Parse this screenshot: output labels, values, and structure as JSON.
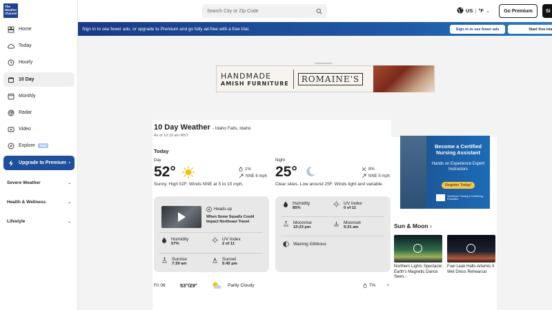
{
  "brand": {
    "logo_text": "The Weather Channel"
  },
  "sidebar": {
    "items": [
      {
        "label": "Home",
        "icon": "home-icon"
      },
      {
        "label": "Today",
        "icon": "cloud-icon"
      },
      {
        "label": "Hourly",
        "icon": "clock-icon"
      },
      {
        "label": "10 Day",
        "icon": "calendar-icon"
      },
      {
        "label": "Monthly",
        "icon": "calendar-grid-icon"
      },
      {
        "label": "Radar",
        "icon": "radar-icon"
      },
      {
        "label": "Video",
        "icon": "video-icon"
      },
      {
        "label": "Explore",
        "icon": "compass-icon",
        "badge": "New"
      },
      {
        "label": "Upgrade to Premium",
        "icon": "bolt-icon"
      }
    ],
    "groups": [
      "Severe Weather",
      "Health & Wellness",
      "Lifestyle"
    ]
  },
  "header": {
    "search_placeholder": "Search City or Zip Code",
    "locale": "US",
    "unit": "°F",
    "premium_button": "Go Premium",
    "signin_button": "Si"
  },
  "banner": {
    "text": "Sign in to see fewer ads, or upgrade to Premium and go fully ad-free with a free trial.",
    "signin_btn": "Sign in to see fewer ads",
    "trial_btn": "Start free trial"
  },
  "top_ad": {
    "label": "Advertisement",
    "line1": "HANDMADE",
    "line2": "AMISH FURNITURE",
    "brand": "ROMAINE'S"
  },
  "main": {
    "title": "10 Day Weather",
    "location": "- Idaho Falls, Idaho",
    "as_of": "As of 10:19 am MST",
    "today_label": "Today",
    "day": {
      "label": "Day",
      "temp": "52°",
      "precip": "1%",
      "wind": "NNE 6 mph",
      "summary": "Sunny. High 52F. Winds NNE at 5 to 10 mph."
    },
    "night": {
      "label": "Night",
      "temp": "25°",
      "precip": "8%",
      "wind": "NNE 5 mph",
      "summary": "Clear skies. Low around 25F. Winds light and variable."
    },
    "day_card": {
      "headsup": "Heads-up",
      "news_title": "When Snow Squalls Could Impact Northeast Travel",
      "humidity_label": "Humidity",
      "humidity": "57%",
      "uv_label": "UV Index",
      "uv": "2 of 11",
      "sunrise_label": "Sunrise",
      "sunrise": "7:39 am",
      "sunset_label": "Sunset",
      "sunset": "5:45 pm"
    },
    "night_card": {
      "humidity_label": "Humidity",
      "humidity": "85%",
      "uv_label": "UV Index",
      "uv": "0 of 11",
      "moonrise_label": "Moonrise",
      "moonrise": "10:23 pm",
      "moonset_label": "Moonset",
      "moonset": "9:21 am",
      "phase": "Waning Gibbous"
    },
    "forecast_row": {
      "day": "Fri 06",
      "temps": "53°/29°",
      "condition": "Partly Cloudy",
      "precip": "7%",
      "expand": "+"
    }
  },
  "right_ad": {
    "heading": "Become a Certified Nursing Assistant",
    "sub": "Hands on Experience Expert Instructors",
    "cta": "Register Today!",
    "org": "Workforce Training & Continuing Education"
  },
  "sun_moon": {
    "title": "Sun & Moon",
    "videos": [
      {
        "caption": "Northern Lights Spectacle: Earth's Magnetic Dance Seen..."
      },
      {
        "caption": "Fuel Leak Halts Artemis II Wet Dress Rehearsal"
      }
    ]
  },
  "colors": {
    "brand_blue": "#1f3f8f",
    "premium_blue": "#1f4f9a",
    "sun_yellow": "#f6c20f",
    "cta_yellow": "#f6c64b"
  }
}
